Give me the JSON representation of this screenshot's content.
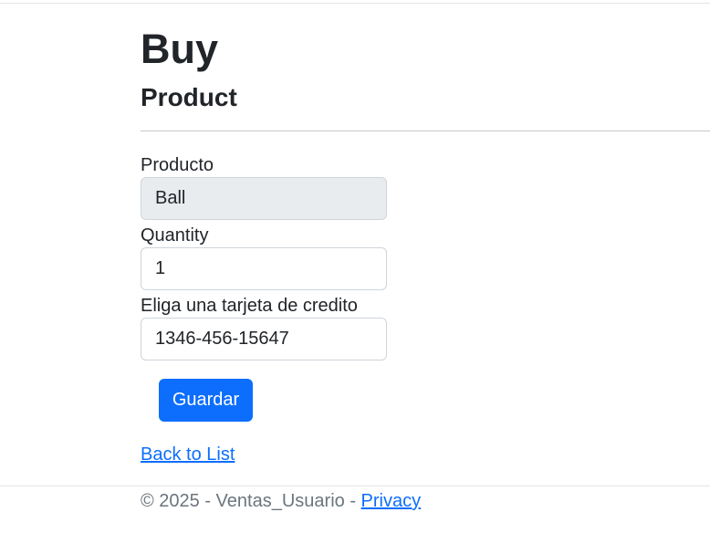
{
  "page": {
    "title": "Buy",
    "subtitle": "Product"
  },
  "form": {
    "product_label": "Producto",
    "product_value": "Ball",
    "quantity_label": "Quantity",
    "quantity_value": "1",
    "card_label": "Eliga una tarjeta de credito",
    "card_value": "1346-456-15647",
    "submit_label": "Guardar"
  },
  "links": {
    "back_to_list": "Back to List"
  },
  "footer": {
    "copyright": "© 2025 - Ventas_Usuario - ",
    "privacy_link": "Privacy"
  },
  "colors": {
    "primary": "#0d6efd",
    "readonly_bg": "#e9ecef",
    "text": "#212529",
    "muted": "#6c757d"
  }
}
